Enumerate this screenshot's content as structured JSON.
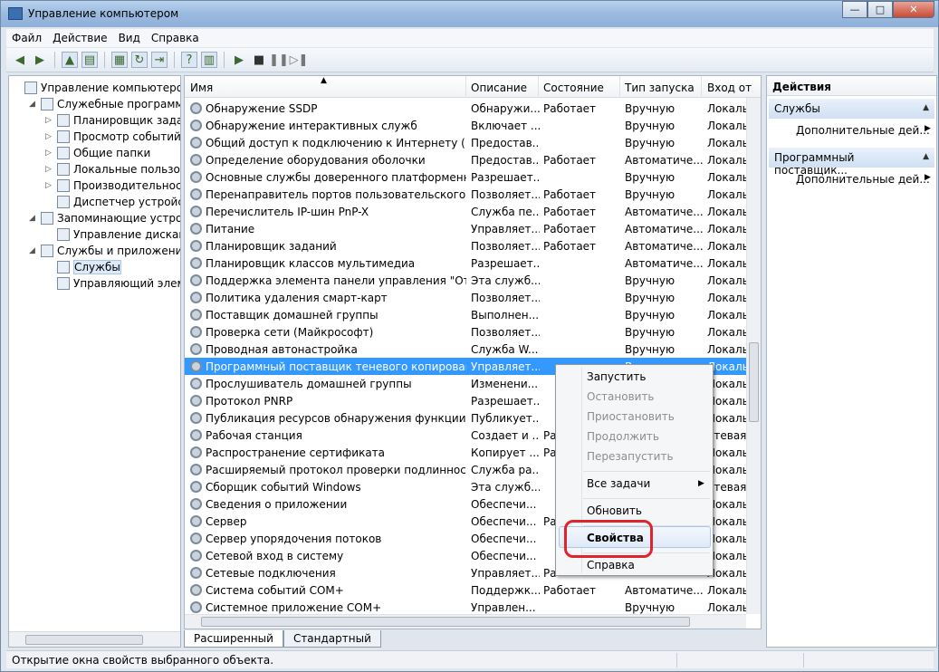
{
  "window": {
    "title": "Управление компьютером",
    "min": "—",
    "max": "□",
    "close": "✕"
  },
  "menu": [
    "Файл",
    "Действие",
    "Вид",
    "Справка"
  ],
  "tree": [
    {
      "label": "Управление компьютером (л",
      "indent": 0,
      "exp": "",
      "icon": "computer-icon"
    },
    {
      "label": "Служебные программы",
      "indent": 1,
      "exp": "◢",
      "icon": "tools-icon"
    },
    {
      "label": "Планировщик заданий",
      "indent": 2,
      "exp": "▷",
      "icon": "clock-icon"
    },
    {
      "label": "Просмотр событий",
      "indent": 2,
      "exp": "▷",
      "icon": "event-viewer-icon"
    },
    {
      "label": "Общие папки",
      "indent": 2,
      "exp": "▷",
      "icon": "shared-folder-icon"
    },
    {
      "label": "Локальные пользовате",
      "indent": 2,
      "exp": "▷",
      "icon": "users-icon"
    },
    {
      "label": "Производительность",
      "indent": 2,
      "exp": "▷",
      "icon": "performance-icon"
    },
    {
      "label": "Диспетчер устройств",
      "indent": 2,
      "exp": "",
      "icon": "device-manager-icon"
    },
    {
      "label": "Запоминающие устройст",
      "indent": 1,
      "exp": "◢",
      "icon": "storage-icon"
    },
    {
      "label": "Управление дисками",
      "indent": 2,
      "exp": "",
      "icon": "disk-icon"
    },
    {
      "label": "Службы и приложения",
      "indent": 1,
      "exp": "◢",
      "icon": "services-apps-icon"
    },
    {
      "label": "Службы",
      "indent": 2,
      "exp": "",
      "icon": "gear-icon",
      "selected": true
    },
    {
      "label": "Управляющий элемен",
      "indent": 2,
      "exp": "",
      "icon": "wmi-icon"
    }
  ],
  "columns": [
    "Имя",
    "Описание",
    "Состояние",
    "Тип запуска",
    "Вход от"
  ],
  "rows": [
    [
      "Обнаружение SSDP",
      "Обнаружи...",
      "Работает",
      "Вручную",
      "Локальн"
    ],
    [
      "Обнаружение интерактивных служб",
      "Включает ...",
      "",
      "Вручную",
      "Локальн"
    ],
    [
      "Общий доступ к подключению к Интернету (ICS)",
      "Предостав...",
      "",
      "Вручную",
      "Локальн"
    ],
    [
      "Определение оборудования оболочки",
      "Предостав...",
      "Работает",
      "Автоматиче...",
      "Локальн"
    ],
    [
      "Основные службы доверенного платформенног...",
      "Разрешает...",
      "",
      "Вручную",
      "Локальн"
    ],
    [
      "Перенаправитель портов пользовательского реж...",
      "Позволяет...",
      "Работает",
      "Вручную",
      "Локальн"
    ],
    [
      "Перечислитель IP-шин PnP-X",
      "Служба пе...",
      "Работает",
      "Автоматиче...",
      "Локальн"
    ],
    [
      "Питание",
      "Управляет...",
      "Работает",
      "Автоматиче...",
      "Локальн"
    ],
    [
      "Планировщик заданий",
      "Позволяет...",
      "Работает",
      "Автоматиче...",
      "Локальн"
    ],
    [
      "Планировщик классов мультимедиа",
      "Разрешает...",
      "",
      "Автоматиче...",
      "Локальн"
    ],
    [
      "Поддержка элемента панели управления \"Отчет...",
      "Эта служб...",
      "",
      "Вручную",
      "Локальн"
    ],
    [
      "Политика удаления смарт-карт",
      "Позволяет...",
      "",
      "Вручную",
      "Локальн"
    ],
    [
      "Поставщик домашней группы",
      "Выполнен...",
      "",
      "Вручную",
      "Локальн"
    ],
    [
      "Проверка сети (Майкрософт)",
      "Позволяет...",
      "",
      "Вручную",
      "Локальн"
    ],
    [
      "Проводная автонастройка",
      "Служба W...",
      "",
      "Вручную",
      "Локальн"
    ],
    [
      "Программный поставщик теневого копирования...",
      "Управляет...",
      "",
      "В",
      "Локальн"
    ],
    [
      "Прослушиватель домашней группы",
      "Изменени...",
      "",
      "",
      "Локальн"
    ],
    [
      "Протокол PNRP",
      "Разрешает...",
      "",
      "",
      "Локальн"
    ],
    [
      "Публикация ресурсов обнаружения функции",
      "Публикует...",
      "",
      "",
      "Локальн"
    ],
    [
      "Рабочая станция",
      "Создает и ...",
      "Ра",
      "",
      "етевая"
    ],
    [
      "Распространение сертификата",
      "Копирует ...",
      "Ра",
      "",
      "Локальн"
    ],
    [
      "Расширяемый протокол проверки подлинности (...",
      "Служба ра...",
      "",
      "",
      "Локальн"
    ],
    [
      "Сборщик событий Windows",
      "Эта служб...",
      "",
      "",
      "етевая"
    ],
    [
      "Сведения о приложении",
      "Обеспечи...",
      "",
      "",
      "Локальн"
    ],
    [
      "Сервер",
      "Обеспечи...",
      "Ра",
      "",
      "Локальн"
    ],
    [
      "Сервер упорядочения потоков",
      "Обеспечи...",
      "",
      "",
      "Локальн"
    ],
    [
      "Сетевой вход в систему",
      "Обеспечи...",
      "",
      "",
      "Локальн"
    ],
    [
      "Сетевые подключения",
      "Управляет...",
      "Ра",
      "",
      "Локальн"
    ],
    [
      "Система событий COM+",
      "Поддержк...",
      "Работает",
      "Автоматиче...",
      "Локальн"
    ],
    [
      "Системное приложение COM+",
      "Управлен...",
      "",
      "Вручную",
      "Локальн"
    ]
  ],
  "selected_row": 15,
  "tabs": [
    "Расширенный",
    "Стандартный"
  ],
  "actions": {
    "title": "Действия",
    "group1": "Службы",
    "item1": "Дополнительные дей...",
    "group2": "Программный поставщик...",
    "item2": "Дополнительные дей..."
  },
  "context_menu": {
    "start": "Запустить",
    "stop": "Остановить",
    "pause": "Приостановить",
    "resume": "Продолжить",
    "restart": "Перезапустить",
    "all_tasks": "Все задачи",
    "refresh": "Обновить",
    "properties": "Свойства",
    "help": "Справка"
  },
  "status": "Открытие окна свойств выбранного объекта.",
  "colors": {
    "selection": "#3399ff",
    "highlight_ring": "#e0242c"
  }
}
